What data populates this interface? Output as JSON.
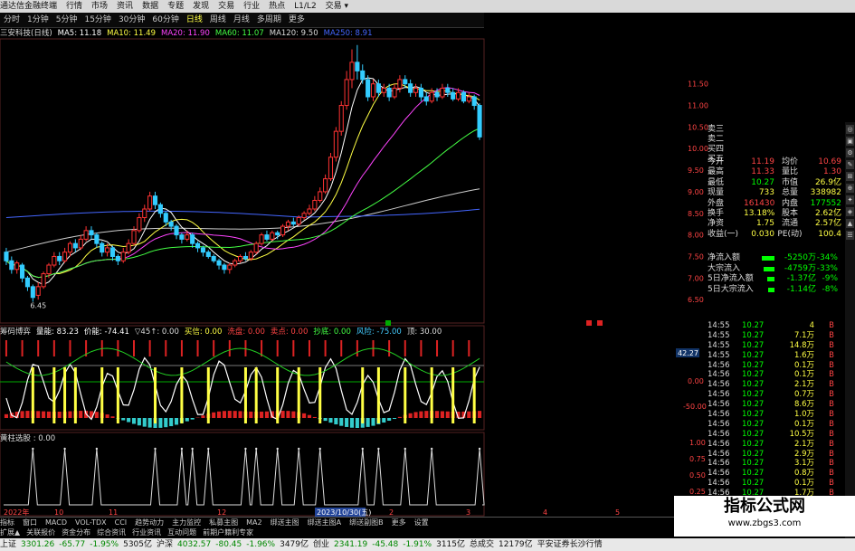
{
  "titlebar": {
    "items": [
      "通达信金融终端",
      "行情",
      "市场",
      "资讯",
      "数据",
      "专题",
      "发现",
      "交易",
      "行业",
      "热点",
      "L1/L2",
      "交易 ▾"
    ]
  },
  "periods": [
    {
      "label": "分时"
    },
    {
      "label": "1分钟"
    },
    {
      "label": "5分钟"
    },
    {
      "label": "15分钟"
    },
    {
      "label": "30分钟"
    },
    {
      "label": "60分钟"
    },
    {
      "label": "日线",
      "active": true
    },
    {
      "label": "周线"
    },
    {
      "label": "月线"
    },
    {
      "label": "多周期"
    },
    {
      "label": "更多"
    }
  ],
  "ma_legend": [
    {
      "text": "三安科技(日线)",
      "color": "#dddddd"
    },
    {
      "text": "MA5: 11.18",
      "color": "#ffffff"
    },
    {
      "text": "MA10: 11.49",
      "color": "#ffff44"
    },
    {
      "text": "MA20: 11.90",
      "color": "#ff44ff"
    },
    {
      "text": "MA60: 11.07",
      "color": "#44ff44"
    },
    {
      "text": "MA120: 9.50",
      "color": "#dddddd"
    },
    {
      "text": "MA250: 8.91",
      "color": "#4466ff"
    }
  ],
  "colors": {
    "up": "#ff3333",
    "down": "#33ccff",
    "ma5": "#ffffff",
    "ma10": "#ffff44",
    "ma20": "#ff44ff",
    "ma60": "#44ff44",
    "ma120": "#cccccc",
    "ma250": "#4466ff",
    "grid": "#551111"
  },
  "price_axis": {
    "min": 6.0,
    "max": 12.5,
    "ticks": [
      "11.50",
      "11.00",
      "10.50",
      "10.00",
      "9.50",
      "9.00",
      "8.50",
      "8.00",
      "7.50",
      "7.00",
      "6.50"
    ]
  },
  "candles": {
    "note_visible": "",
    "low_label": "6.45",
    "series": [
      [
        7.6,
        7.4,
        7.7,
        7.3
      ],
      [
        7.4,
        7.2,
        7.5,
        7.1
      ],
      [
        7.2,
        7.35,
        7.4,
        7.1
      ],
      [
        7.3,
        7.0,
        7.35,
        6.9
      ],
      [
        7.0,
        6.8,
        7.05,
        6.7
      ],
      [
        6.8,
        6.55,
        6.85,
        6.45
      ],
      [
        6.6,
        6.8,
        6.9,
        6.5
      ],
      [
        6.8,
        7.1,
        7.15,
        6.75
      ],
      [
        7.1,
        7.3,
        7.35,
        7.0
      ],
      [
        7.3,
        7.5,
        7.6,
        7.25
      ],
      [
        7.5,
        7.4,
        7.6,
        7.3
      ],
      [
        7.4,
        7.6,
        7.7,
        7.35
      ],
      [
        7.6,
        7.8,
        7.85,
        7.5
      ],
      [
        7.8,
        7.7,
        7.9,
        7.6
      ],
      [
        7.7,
        7.9,
        8.0,
        7.65
      ],
      [
        7.9,
        8.1,
        8.2,
        7.85
      ],
      [
        8.1,
        8.0,
        8.2,
        7.9
      ],
      [
        8.0,
        7.8,
        8.05,
        7.7
      ],
      [
        7.8,
        7.6,
        7.85,
        7.5
      ],
      [
        7.6,
        7.7,
        7.8,
        7.5
      ],
      [
        7.7,
        7.5,
        7.75,
        7.4
      ],
      [
        7.5,
        7.4,
        7.55,
        7.3
      ],
      [
        7.4,
        7.6,
        7.7,
        7.35
      ],
      [
        7.6,
        7.8,
        7.9,
        7.55
      ],
      [
        7.8,
        8.1,
        8.2,
        7.75
      ],
      [
        8.1,
        8.4,
        8.5,
        8.05
      ],
      [
        8.4,
        8.6,
        8.7,
        8.3
      ],
      [
        8.6,
        8.9,
        9.0,
        8.55
      ],
      [
        8.9,
        8.7,
        9.0,
        8.6
      ],
      [
        8.7,
        8.5,
        8.75,
        8.4
      ],
      [
        8.5,
        8.3,
        8.55,
        8.2
      ],
      [
        8.3,
        8.2,
        8.35,
        8.1
      ],
      [
        8.2,
        8.0,
        8.25,
        7.9
      ],
      [
        8.0,
        7.9,
        8.05,
        7.8
      ],
      [
        7.9,
        8.0,
        8.1,
        7.85
      ],
      [
        8.0,
        7.8,
        8.05,
        7.7
      ],
      [
        7.8,
        7.7,
        7.85,
        7.6
      ],
      [
        7.7,
        7.6,
        7.75,
        7.5
      ],
      [
        7.6,
        7.5,
        7.65,
        7.45
      ],
      [
        7.5,
        7.4,
        7.55,
        7.35
      ],
      [
        7.4,
        7.3,
        7.45,
        7.2
      ],
      [
        7.3,
        7.2,
        7.35,
        7.1
      ],
      [
        7.2,
        7.3,
        7.35,
        7.1
      ],
      [
        7.3,
        7.4,
        7.45,
        7.25
      ],
      [
        7.4,
        7.5,
        7.55,
        7.35
      ],
      [
        7.5,
        7.45,
        7.6,
        7.4
      ],
      [
        7.45,
        7.6,
        7.65,
        7.4
      ],
      [
        7.6,
        7.8,
        7.85,
        7.55
      ],
      [
        7.8,
        8.0,
        8.05,
        7.75
      ],
      [
        8.0,
        7.9,
        8.1,
        7.85
      ],
      [
        7.9,
        8.05,
        8.1,
        7.85
      ],
      [
        8.05,
        8.0,
        8.1,
        7.9
      ],
      [
        8.0,
        8.2,
        8.25,
        7.95
      ],
      [
        8.2,
        8.3,
        8.35,
        8.1
      ],
      [
        8.3,
        8.25,
        8.4,
        8.2
      ],
      [
        8.25,
        8.4,
        8.45,
        8.2
      ],
      [
        8.4,
        8.5,
        8.55,
        8.35
      ],
      [
        8.5,
        8.6,
        8.7,
        8.45
      ],
      [
        8.6,
        8.8,
        8.9,
        8.55
      ],
      [
        8.8,
        9.0,
        9.1,
        8.75
      ],
      [
        9.0,
        9.3,
        9.4,
        8.95
      ],
      [
        9.3,
        9.8,
        9.9,
        9.25
      ],
      [
        9.8,
        10.4,
        10.5,
        9.7
      ],
      [
        10.4,
        11.0,
        11.1,
        10.3
      ],
      [
        11.0,
        11.6,
        11.8,
        10.9
      ],
      [
        11.6,
        12.0,
        12.3,
        11.4
      ],
      [
        12.0,
        11.8,
        12.4,
        11.6
      ],
      [
        11.8,
        11.6,
        11.95,
        11.5
      ],
      [
        11.6,
        11.2,
        11.7,
        11.1
      ],
      [
        11.2,
        11.5,
        11.6,
        11.1
      ],
      [
        11.5,
        11.3,
        11.6,
        11.2
      ],
      [
        11.3,
        11.4,
        11.5,
        11.2
      ],
      [
        11.4,
        11.2,
        11.5,
        11.1
      ],
      [
        11.2,
        11.4,
        11.5,
        11.15
      ],
      [
        11.4,
        11.6,
        11.7,
        11.3
      ],
      [
        11.6,
        11.5,
        11.7,
        11.4
      ],
      [
        11.5,
        11.3,
        11.6,
        11.2
      ],
      [
        11.3,
        11.4,
        11.5,
        11.2
      ],
      [
        11.4,
        11.2,
        11.5,
        11.1
      ],
      [
        11.2,
        11.1,
        11.3,
        11.0
      ],
      [
        11.1,
        11.3,
        11.4,
        11.05
      ],
      [
        11.3,
        11.2,
        11.4,
        11.1
      ],
      [
        11.2,
        11.4,
        11.5,
        11.15
      ],
      [
        11.4,
        11.3,
        11.5,
        11.2
      ],
      [
        11.3,
        11.15,
        11.4,
        11.1
      ],
      [
        11.15,
        11.3,
        11.4,
        11.1
      ],
      [
        11.3,
        11.1,
        11.35,
        11.05
      ],
      [
        11.1,
        11.2,
        11.3,
        11.05
      ],
      [
        11.2,
        11.0,
        11.25,
        10.9
      ],
      [
        11.0,
        10.27,
        11.05,
        10.2
      ]
    ]
  },
  "quote": {
    "header": [
      "卖三",
      "卖二",
      "买四",
      "买五"
    ],
    "rows": [
      {
        "l1": "今开",
        "v1": "11.19",
        "l2": "均价",
        "v2": "10.69",
        "c1": "#ff4444",
        "c2": "#ff4444"
      },
      {
        "l1": "最高",
        "v1": "11.33",
        "l2": "量比",
        "v2": "1.30",
        "c1": "#ff4444",
        "c2": "#ff4444"
      },
      {
        "l1": "最低",
        "v1": "10.27",
        "l2": "市值",
        "v2": "26.9亿",
        "c1": "#00ff00",
        "c2": "#ffff44"
      },
      {
        "l1": "现量",
        "v1": "733",
        "l2": "总量",
        "v2": "338982",
        "c1": "#ffff44",
        "c2": "#ffff44"
      },
      {
        "l1": "外盘",
        "v1": "161430",
        "l2": "内盘",
        "v2": "177552",
        "c1": "#ff4444",
        "c2": "#00ff00"
      },
      {
        "l1": "换手",
        "v1": "13.18%",
        "l2": "股本",
        "v2": "2.62亿",
        "c1": "#ffff44",
        "c2": "#ffff44"
      },
      {
        "l1": "净资",
        "v1": "1.75",
        "l2": "流通",
        "v2": "2.57亿",
        "c1": "#ffff44",
        "c2": "#ffff44"
      },
      {
        "l1": "收益(一)",
        "v1": "0.030",
        "l2": "PE(动)",
        "v2": "100.4",
        "c1": "#ffff44",
        "c2": "#ffff44"
      }
    ]
  },
  "flow": [
    {
      "label": "净流入额",
      "value": "-5250万",
      "pct": "-34%",
      "bar": 14
    },
    {
      "label": "大宗流入",
      "value": "-4759万",
      "pct": "-33%",
      "bar": 12
    },
    {
      "label": "5日净流入额",
      "value": "-1.37亿",
      "pct": "-9%",
      "bar": 8
    },
    {
      "label": "5日大宗流入",
      "value": "-1.14亿",
      "pct": "-8%",
      "bar": 7
    }
  ],
  "ticks": [
    {
      "t": "14:55",
      "p": "10.27",
      "v": "4",
      "bs": "B"
    },
    {
      "t": "14:55",
      "p": "10.27",
      "v": "7.1万",
      "bs": "B"
    },
    {
      "t": "14:55",
      "p": "10.27",
      "v": "14.8万",
      "bs": "B"
    },
    {
      "t": "14:55",
      "p": "10.27",
      "v": "1.6万",
      "bs": "B"
    },
    {
      "t": "14:56",
      "p": "10.27",
      "v": "0.1万",
      "bs": "B"
    },
    {
      "t": "14:56",
      "p": "10.27",
      "v": "0.1万",
      "bs": "B"
    },
    {
      "t": "14:56",
      "p": "10.27",
      "v": "2.1万",
      "bs": "B"
    },
    {
      "t": "14:56",
      "p": "10.27",
      "v": "0.7万",
      "bs": "B"
    },
    {
      "t": "14:56",
      "p": "10.27",
      "v": "8.6万",
      "bs": "B"
    },
    {
      "t": "14:56",
      "p": "10.27",
      "v": "1.0万",
      "bs": "B"
    },
    {
      "t": "14:56",
      "p": "10.27",
      "v": "0.1万",
      "bs": "B"
    },
    {
      "t": "14:56",
      "p": "10.27",
      "v": "10.5万",
      "bs": "B"
    },
    {
      "t": "14:56",
      "p": "10.27",
      "v": "2.1万",
      "bs": "B"
    },
    {
      "t": "14:56",
      "p": "10.27",
      "v": "2.9万",
      "bs": "B"
    },
    {
      "t": "14:56",
      "p": "10.27",
      "v": "3.1万",
      "bs": "B"
    },
    {
      "t": "14:56",
      "p": "10.27",
      "v": "0.8万",
      "bs": "B"
    },
    {
      "t": "14:56",
      "p": "10.27",
      "v": "0.1万",
      "bs": "B"
    },
    {
      "t": "14:56",
      "p": "10.27",
      "v": "1.7万",
      "bs": "B"
    },
    {
      "t": "14:56",
      "p": "10.27",
      "v": "0.1万",
      "bs": "B"
    }
  ],
  "ind1": {
    "legend": [
      {
        "text": "筹码博弈",
        "color": "#dddddd"
      },
      {
        "text": "量能: 83.23",
        "color": "#ffffff"
      },
      {
        "text": "价能: -74.41",
        "color": "#ffffff"
      },
      {
        "text": "▽45↑: 0.00",
        "color": "#dddddd"
      },
      {
        "text": "买信: 0.00",
        "color": "#ffff44"
      },
      {
        "text": "洗盘: 0.00",
        "color": "#ff4444"
      },
      {
        "text": "卖点: 0.00",
        "color": "#ff4444"
      },
      {
        "text": "抄底: 0.00",
        "color": "#44ff44"
      },
      {
        "text": "风险: -75.00",
        "color": "#44ccff"
      },
      {
        "text": "顶: 30.00",
        "color": "#dddddd"
      }
    ],
    "axis": [
      "42.27",
      "0.00",
      "-50.00"
    ],
    "signals": [
      5,
      9,
      11,
      13,
      18,
      21,
      28,
      33,
      38,
      45,
      47,
      51,
      55,
      59,
      67,
      70,
      75,
      80,
      84,
      88
    ]
  },
  "ind2": {
    "legend": "黄柱选股 : 0.00",
    "axis": [
      "1.00",
      "0.75",
      "0.50",
      "0.25"
    ],
    "spikes": [
      5,
      11,
      17,
      28,
      33,
      35,
      38,
      45,
      47,
      51,
      55,
      59,
      67,
      70,
      75,
      80,
      89
    ]
  },
  "date_axis": {
    "labels": [
      "2022年",
      "10",
      "11",
      "12",
      "2023/10/30(五)",
      "2",
      "3",
      "4",
      "5"
    ],
    "selected": "2023/10/30(五)"
  },
  "tabs": [
    "指标",
    "窗口",
    "MACD",
    "VOL-TDX",
    "CCI",
    "趋势动力",
    "主力监控",
    "私募主图",
    "MA2",
    "绑送主图",
    "绑送主图A",
    "绑送副图B",
    "更多",
    "设置"
  ],
  "tabs2": [
    "扩展▲",
    "关联报价",
    "资金分布",
    "综合资讯",
    "行业资讯",
    "互动问题",
    "前期户籍利专家"
  ],
  "status": [
    {
      "text": "上证",
      "cls": ""
    },
    {
      "text": "3301.26",
      "cls": "dn"
    },
    {
      "text": "-65.77",
      "cls": "dn"
    },
    {
      "text": "-1.95%",
      "cls": "dn"
    },
    {
      "text": "5305亿",
      "cls": ""
    },
    {
      "text": "沪深",
      "cls": ""
    },
    {
      "text": "4032.57",
      "cls": "dn"
    },
    {
      "text": "-80.45",
      "cls": "dn"
    },
    {
      "text": "-1.96%",
      "cls": "dn"
    },
    {
      "text": "3479亿",
      "cls": ""
    },
    {
      "text": "创业",
      "cls": ""
    },
    {
      "text": "2341.19",
      "cls": "dn"
    },
    {
      "text": "-45.48",
      "cls": "dn"
    },
    {
      "text": "-1.91%",
      "cls": "dn"
    },
    {
      "text": "3115亿",
      "cls": ""
    },
    {
      "text": "总成交",
      "cls": ""
    },
    {
      "text": "12179亿",
      "cls": ""
    },
    {
      "text": "平安证券长沙行情",
      "cls": ""
    }
  ],
  "watermark": {
    "line1": "指标公式网",
    "line2": "www.zbgs3.com"
  }
}
